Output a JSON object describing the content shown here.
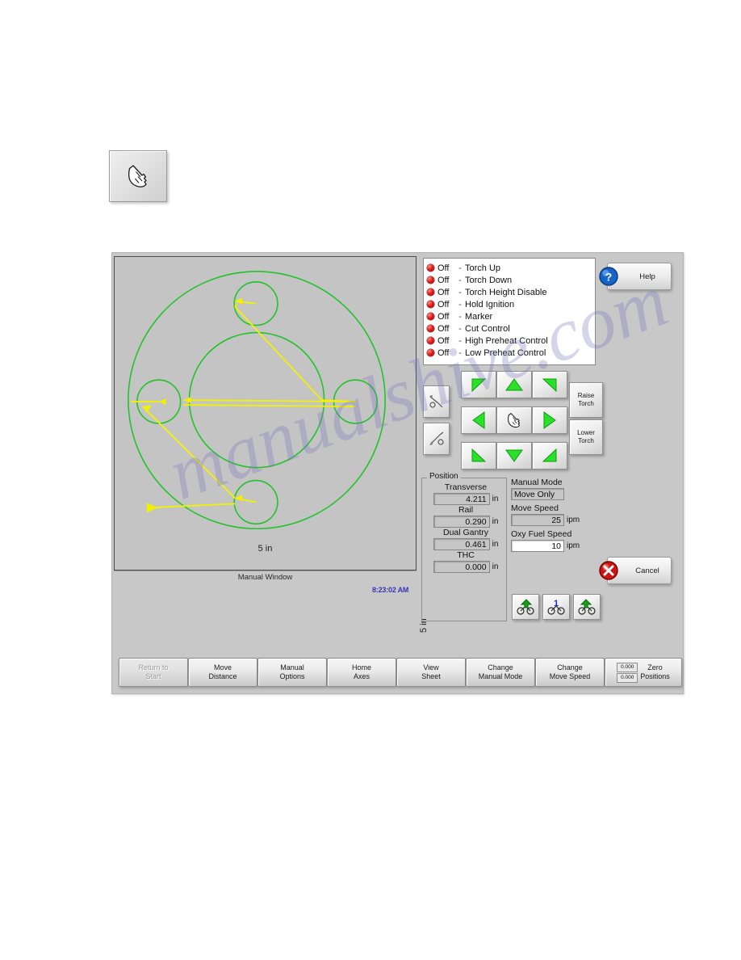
{
  "page": {
    "hand_button": {
      "icon": "pointing-hand-icon"
    }
  },
  "app": {
    "caption": "Manual Window",
    "clock": "8:23:02 AM",
    "graphics": {
      "dim_horizontal": "5 in",
      "dim_vertical": "5 in",
      "part_color": "#22c32a",
      "path_color": "#f2f200",
      "background": "#c4c4c4"
    },
    "status": {
      "led_color": "#e02020",
      "rows": [
        {
          "state": "Off",
          "dash": "-",
          "name": "Torch Up"
        },
        {
          "state": "Off",
          "dash": "-",
          "name": "Torch Down"
        },
        {
          "state": "Off",
          "dash": "-",
          "name": "Torch Height Disable"
        },
        {
          "state": "Off",
          "dash": "-",
          "name": "Hold Ignition"
        },
        {
          "state": "Off",
          "dash": "-",
          "name": "Marker"
        },
        {
          "state": "Off",
          "dash": "-",
          "name": "Cut Control"
        },
        {
          "state": "Off",
          "dash": "-",
          "name": "High Preheat Control"
        },
        {
          "state": "Off",
          "dash": "-",
          "name": "Low Preheat Control"
        }
      ]
    },
    "help_button": {
      "label": "Help",
      "icon": "question-mark-icon"
    },
    "cancel_button": {
      "label": "Cancel",
      "icon": "red-x-icon"
    },
    "jog": {
      "keys": [
        "jog-up-left",
        "jog-up",
        "jog-up-right",
        "jog-left",
        "jog-center-hand",
        "jog-right",
        "jog-down-left",
        "jog-down",
        "jog-down-right"
      ],
      "side_buttons": [
        "torch-lead-in-icon",
        "torch-lead-out-icon"
      ],
      "raise_torch": {
        "line1": "Raise",
        "line2": "Torch"
      },
      "lower_torch": {
        "line1": "Lower",
        "line2": "Torch"
      }
    },
    "position": {
      "group_title": "Position",
      "fields": [
        {
          "label": "Transverse",
          "value": "4.211",
          "unit": "in",
          "editable": false
        },
        {
          "label": "Rail",
          "value": "0.290",
          "unit": "in",
          "editable": false
        },
        {
          "label": "Dual Gantry",
          "value": "0.461",
          "unit": "in",
          "editable": false
        },
        {
          "label": "THC",
          "value": "0.000",
          "unit": "in",
          "editable": false
        }
      ]
    },
    "right_fields": [
      {
        "label": "Manual Mode",
        "value": "Move Only",
        "unit": "",
        "editable": false,
        "align": "left"
      },
      {
        "label": "Move Speed",
        "value": "25",
        "unit": "ipm",
        "editable": false,
        "align": "right"
      },
      {
        "label": "Oxy Fuel Speed",
        "value": "10",
        "unit": "ipm",
        "editable": true,
        "align": "right"
      }
    ],
    "stations": [
      {
        "name": "station-prev",
        "label": ""
      },
      {
        "name": "station-number",
        "label": "1"
      },
      {
        "name": "station-next",
        "label": ""
      }
    ],
    "toolbar": [
      {
        "line1": "Return to",
        "line2": "Start",
        "disabled": true
      },
      {
        "line1": "Move",
        "line2": "Distance",
        "disabled": false
      },
      {
        "line1": "Manual",
        "line2": "Options",
        "disabled": false
      },
      {
        "line1": "Home",
        "line2": "Axes",
        "disabled": false
      },
      {
        "line1": "View",
        "line2": "Sheet",
        "disabled": false
      },
      {
        "line1": "Change",
        "line2": "Manual Mode",
        "disabled": false
      },
      {
        "line1": "Change",
        "line2": "Move Speed",
        "disabled": false
      }
    ],
    "zero_positions": {
      "line1": "Zero",
      "line2": "Positions",
      "value_top": "0.000",
      "value_bottom": "0.000"
    }
  },
  "watermark": {
    "text": "manualshive.com"
  }
}
